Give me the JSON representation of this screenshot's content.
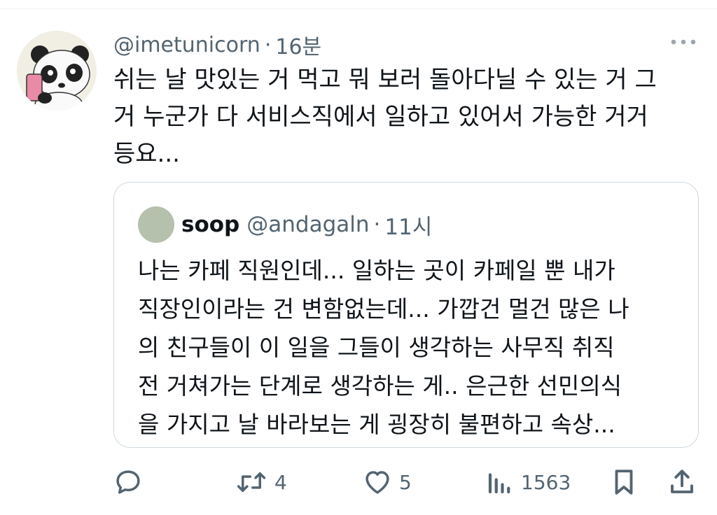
{
  "post": {
    "handle": "@imetunicorn",
    "separator": "·",
    "time": "16분",
    "text_lines": [
      "쉬는 날 맛있는 거 먹고 뭐 보러 돌아다닐 수 있는 거 그",
      "거 누군가 다 서비스직에서 일하고 있어서 가능한 거거",
      "등요..."
    ],
    "avatar_icon": "panda-avatar-icon",
    "more_icon": "more-dots-icon"
  },
  "quote": {
    "name": "soop",
    "handle": "@andagaln",
    "separator": "·",
    "time": "11시",
    "text_lines": [
      "나는 카페 직원인데... 일하는 곳이 카페일 뿐 내가",
      "직장인이라는 건 변함없는데... 가깝건 멀건 많은 나",
      "의 친구들이 이 일을 그들이 생각하는 사무직 취직",
      "전 거쳐가는 단계로 생각하는 게.. 은근한 선민의식",
      "을 가지고 날 바라보는 게 굉장히 불편하고 속상..."
    ],
    "avatar_color": "#b5c1ad"
  },
  "actions": {
    "reply": {
      "icon": "reply-icon",
      "count": ""
    },
    "repost": {
      "icon": "repost-icon",
      "count": "4"
    },
    "like": {
      "icon": "heart-icon",
      "count": "5"
    },
    "views": {
      "icon": "views-icon",
      "count": "1563"
    },
    "bookmark": {
      "icon": "bookmark-icon"
    },
    "share": {
      "icon": "share-icon"
    }
  },
  "colors": {
    "text": "#0f1419",
    "secondary": "#536471",
    "border": "#cfd9de"
  }
}
